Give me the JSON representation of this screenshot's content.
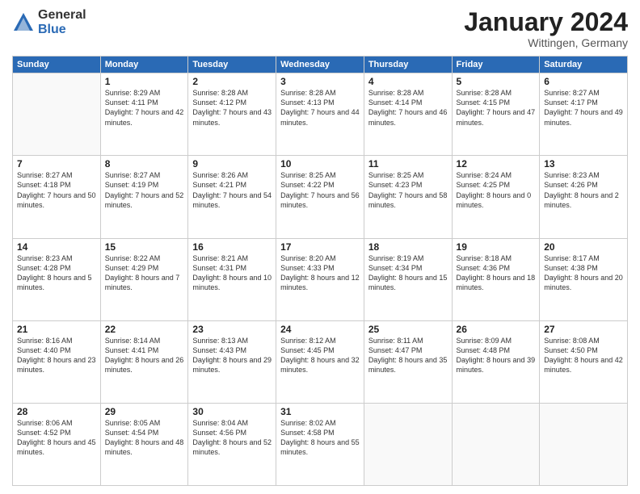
{
  "logo": {
    "general": "General",
    "blue": "Blue"
  },
  "title": "January 2024",
  "subtitle": "Wittingen, Germany",
  "days_header": [
    "Sunday",
    "Monday",
    "Tuesday",
    "Wednesday",
    "Thursday",
    "Friday",
    "Saturday"
  ],
  "weeks": [
    [
      {
        "num": "",
        "sunrise": "",
        "sunset": "",
        "daylight": ""
      },
      {
        "num": "1",
        "sunrise": "Sunrise: 8:29 AM",
        "sunset": "Sunset: 4:11 PM",
        "daylight": "Daylight: 7 hours and 42 minutes."
      },
      {
        "num": "2",
        "sunrise": "Sunrise: 8:28 AM",
        "sunset": "Sunset: 4:12 PM",
        "daylight": "Daylight: 7 hours and 43 minutes."
      },
      {
        "num": "3",
        "sunrise": "Sunrise: 8:28 AM",
        "sunset": "Sunset: 4:13 PM",
        "daylight": "Daylight: 7 hours and 44 minutes."
      },
      {
        "num": "4",
        "sunrise": "Sunrise: 8:28 AM",
        "sunset": "Sunset: 4:14 PM",
        "daylight": "Daylight: 7 hours and 46 minutes."
      },
      {
        "num": "5",
        "sunrise": "Sunrise: 8:28 AM",
        "sunset": "Sunset: 4:15 PM",
        "daylight": "Daylight: 7 hours and 47 minutes."
      },
      {
        "num": "6",
        "sunrise": "Sunrise: 8:27 AM",
        "sunset": "Sunset: 4:17 PM",
        "daylight": "Daylight: 7 hours and 49 minutes."
      }
    ],
    [
      {
        "num": "7",
        "sunrise": "Sunrise: 8:27 AM",
        "sunset": "Sunset: 4:18 PM",
        "daylight": "Daylight: 7 hours and 50 minutes."
      },
      {
        "num": "8",
        "sunrise": "Sunrise: 8:27 AM",
        "sunset": "Sunset: 4:19 PM",
        "daylight": "Daylight: 7 hours and 52 minutes."
      },
      {
        "num": "9",
        "sunrise": "Sunrise: 8:26 AM",
        "sunset": "Sunset: 4:21 PM",
        "daylight": "Daylight: 7 hours and 54 minutes."
      },
      {
        "num": "10",
        "sunrise": "Sunrise: 8:25 AM",
        "sunset": "Sunset: 4:22 PM",
        "daylight": "Daylight: 7 hours and 56 minutes."
      },
      {
        "num": "11",
        "sunrise": "Sunrise: 8:25 AM",
        "sunset": "Sunset: 4:23 PM",
        "daylight": "Daylight: 7 hours and 58 minutes."
      },
      {
        "num": "12",
        "sunrise": "Sunrise: 8:24 AM",
        "sunset": "Sunset: 4:25 PM",
        "daylight": "Daylight: 8 hours and 0 minutes."
      },
      {
        "num": "13",
        "sunrise": "Sunrise: 8:23 AM",
        "sunset": "Sunset: 4:26 PM",
        "daylight": "Daylight: 8 hours and 2 minutes."
      }
    ],
    [
      {
        "num": "14",
        "sunrise": "Sunrise: 8:23 AM",
        "sunset": "Sunset: 4:28 PM",
        "daylight": "Daylight: 8 hours and 5 minutes."
      },
      {
        "num": "15",
        "sunrise": "Sunrise: 8:22 AM",
        "sunset": "Sunset: 4:29 PM",
        "daylight": "Daylight: 8 hours and 7 minutes."
      },
      {
        "num": "16",
        "sunrise": "Sunrise: 8:21 AM",
        "sunset": "Sunset: 4:31 PM",
        "daylight": "Daylight: 8 hours and 10 minutes."
      },
      {
        "num": "17",
        "sunrise": "Sunrise: 8:20 AM",
        "sunset": "Sunset: 4:33 PM",
        "daylight": "Daylight: 8 hours and 12 minutes."
      },
      {
        "num": "18",
        "sunrise": "Sunrise: 8:19 AM",
        "sunset": "Sunset: 4:34 PM",
        "daylight": "Daylight: 8 hours and 15 minutes."
      },
      {
        "num": "19",
        "sunrise": "Sunrise: 8:18 AM",
        "sunset": "Sunset: 4:36 PM",
        "daylight": "Daylight: 8 hours and 18 minutes."
      },
      {
        "num": "20",
        "sunrise": "Sunrise: 8:17 AM",
        "sunset": "Sunset: 4:38 PM",
        "daylight": "Daylight: 8 hours and 20 minutes."
      }
    ],
    [
      {
        "num": "21",
        "sunrise": "Sunrise: 8:16 AM",
        "sunset": "Sunset: 4:40 PM",
        "daylight": "Daylight: 8 hours and 23 minutes."
      },
      {
        "num": "22",
        "sunrise": "Sunrise: 8:14 AM",
        "sunset": "Sunset: 4:41 PM",
        "daylight": "Daylight: 8 hours and 26 minutes."
      },
      {
        "num": "23",
        "sunrise": "Sunrise: 8:13 AM",
        "sunset": "Sunset: 4:43 PM",
        "daylight": "Daylight: 8 hours and 29 minutes."
      },
      {
        "num": "24",
        "sunrise": "Sunrise: 8:12 AM",
        "sunset": "Sunset: 4:45 PM",
        "daylight": "Daylight: 8 hours and 32 minutes."
      },
      {
        "num": "25",
        "sunrise": "Sunrise: 8:11 AM",
        "sunset": "Sunset: 4:47 PM",
        "daylight": "Daylight: 8 hours and 35 minutes."
      },
      {
        "num": "26",
        "sunrise": "Sunrise: 8:09 AM",
        "sunset": "Sunset: 4:48 PM",
        "daylight": "Daylight: 8 hours and 39 minutes."
      },
      {
        "num": "27",
        "sunrise": "Sunrise: 8:08 AM",
        "sunset": "Sunset: 4:50 PM",
        "daylight": "Daylight: 8 hours and 42 minutes."
      }
    ],
    [
      {
        "num": "28",
        "sunrise": "Sunrise: 8:06 AM",
        "sunset": "Sunset: 4:52 PM",
        "daylight": "Daylight: 8 hours and 45 minutes."
      },
      {
        "num": "29",
        "sunrise": "Sunrise: 8:05 AM",
        "sunset": "Sunset: 4:54 PM",
        "daylight": "Daylight: 8 hours and 48 minutes."
      },
      {
        "num": "30",
        "sunrise": "Sunrise: 8:04 AM",
        "sunset": "Sunset: 4:56 PM",
        "daylight": "Daylight: 8 hours and 52 minutes."
      },
      {
        "num": "31",
        "sunrise": "Sunrise: 8:02 AM",
        "sunset": "Sunset: 4:58 PM",
        "daylight": "Daylight: 8 hours and 55 minutes."
      },
      {
        "num": "",
        "sunrise": "",
        "sunset": "",
        "daylight": ""
      },
      {
        "num": "",
        "sunrise": "",
        "sunset": "",
        "daylight": ""
      },
      {
        "num": "",
        "sunrise": "",
        "sunset": "",
        "daylight": ""
      }
    ]
  ]
}
